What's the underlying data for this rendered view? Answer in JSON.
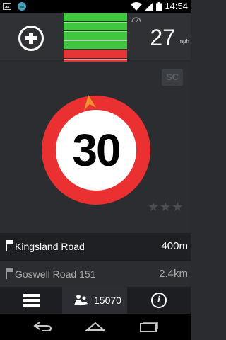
{
  "status_bar": {
    "time": "14:54",
    "left_icons": [
      "image-notification-icon",
      "app-notification-icon"
    ],
    "right_icons": [
      "wifi-icon",
      "signal-icon",
      "battery-icon"
    ]
  },
  "top_bar": {
    "add_icon": "plus-circle-icon",
    "signal_bars": [
      "green",
      "green",
      "green",
      "green",
      "red",
      "red"
    ],
    "speed": "27",
    "speed_unit": "mph"
  },
  "main": {
    "sc_badge": "SC",
    "speed_limit": "30",
    "rating_stars": 3,
    "colors": {
      "sign_red": "#ea3031",
      "arrow_orange": "#f0922b",
      "bar_green": "#3fc83f",
      "bar_red": "#e53535"
    }
  },
  "streets": [
    {
      "name": "Kingsland Road",
      "distance": "400m"
    },
    {
      "name": "Goswell Road 151",
      "distance": "2.4km"
    }
  ],
  "bottom_bar": {
    "stats_value": "15070"
  }
}
